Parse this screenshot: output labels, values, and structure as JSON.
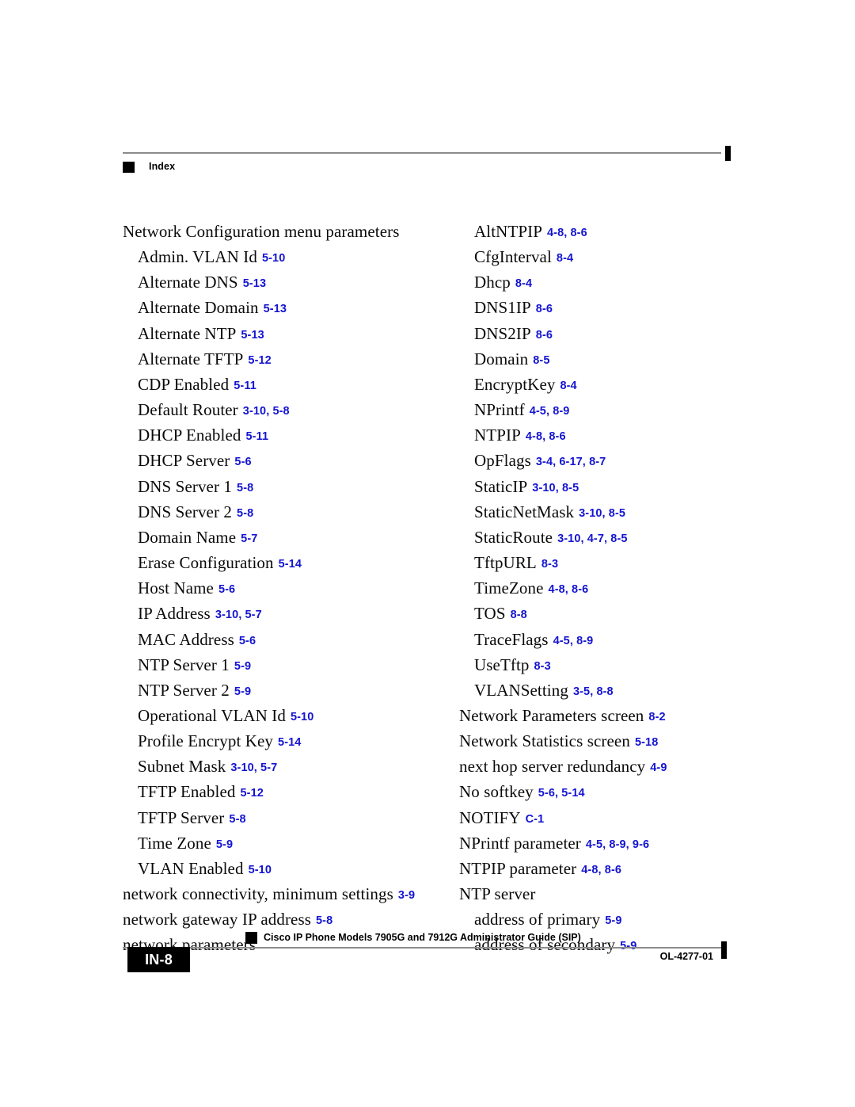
{
  "header": {
    "section_label": "Index"
  },
  "columns": {
    "left": [
      {
        "level": 1,
        "term": "Network Configuration menu parameters",
        "refs": ""
      },
      {
        "level": 2,
        "term": "Admin. VLAN Id",
        "refs": "5-10"
      },
      {
        "level": 2,
        "term": "Alternate DNS",
        "refs": "5-13"
      },
      {
        "level": 2,
        "term": "Alternate Domain",
        "refs": "5-13"
      },
      {
        "level": 2,
        "term": "Alternate NTP",
        "refs": "5-13"
      },
      {
        "level": 2,
        "term": "Alternate TFTP",
        "refs": "5-12"
      },
      {
        "level": 2,
        "term": "CDP Enabled",
        "refs": "5-11"
      },
      {
        "level": 2,
        "term": "Default Router",
        "refs": "3-10, 5-8"
      },
      {
        "level": 2,
        "term": "DHCP Enabled",
        "refs": "5-11"
      },
      {
        "level": 2,
        "term": "DHCP Server",
        "refs": "5-6"
      },
      {
        "level": 2,
        "term": "DNS Server 1",
        "refs": "5-8"
      },
      {
        "level": 2,
        "term": "DNS Server 2",
        "refs": "5-8"
      },
      {
        "level": 2,
        "term": "Domain Name",
        "refs": "5-7"
      },
      {
        "level": 2,
        "term": "Erase Configuration",
        "refs": "5-14"
      },
      {
        "level": 2,
        "term": "Host Name",
        "refs": "5-6"
      },
      {
        "level": 2,
        "term": "IP Address",
        "refs": "3-10, 5-7"
      },
      {
        "level": 2,
        "term": "MAC Address",
        "refs": "5-6"
      },
      {
        "level": 2,
        "term": "NTP Server 1",
        "refs": "5-9"
      },
      {
        "level": 2,
        "term": "NTP Server 2",
        "refs": "5-9"
      },
      {
        "level": 2,
        "term": "Operational VLAN Id",
        "refs": "5-10"
      },
      {
        "level": 2,
        "term": "Profile Encrypt Key",
        "refs": "5-14"
      },
      {
        "level": 2,
        "term": "Subnet Mask",
        "refs": "3-10, 5-7"
      },
      {
        "level": 2,
        "term": "TFTP Enabled",
        "refs": "5-12"
      },
      {
        "level": 2,
        "term": "TFTP Server",
        "refs": "5-8"
      },
      {
        "level": 2,
        "term": "Time Zone",
        "refs": "5-9"
      },
      {
        "level": 2,
        "term": "VLAN Enabled",
        "refs": "5-10"
      },
      {
        "level": 1,
        "term": "network connectivity, minimum settings",
        "refs": "3-9"
      },
      {
        "level": 1,
        "term": "network gateway IP address",
        "refs": "5-8"
      },
      {
        "level": 1,
        "term": "network parameters",
        "refs": ""
      }
    ],
    "right": [
      {
        "level": 2,
        "term": "AltNTPIP",
        "refs": "4-8, 8-6"
      },
      {
        "level": 2,
        "term": "CfgInterval",
        "refs": "8-4"
      },
      {
        "level": 2,
        "term": "Dhcp",
        "refs": "8-4"
      },
      {
        "level": 2,
        "term": "DNS1IP",
        "refs": "8-6"
      },
      {
        "level": 2,
        "term": "DNS2IP",
        "refs": "8-6"
      },
      {
        "level": 2,
        "term": "Domain",
        "refs": "8-5"
      },
      {
        "level": 2,
        "term": "EncryptKey",
        "refs": "8-4"
      },
      {
        "level": 2,
        "term": "NPrintf",
        "refs": "4-5, 8-9"
      },
      {
        "level": 2,
        "term": "NTPIP",
        "refs": "4-8, 8-6"
      },
      {
        "level": 2,
        "term": "OpFlags",
        "refs": "3-4, 6-17, 8-7"
      },
      {
        "level": 2,
        "term": "StaticIP",
        "refs": "3-10, 8-5"
      },
      {
        "level": 2,
        "term": "StaticNetMask",
        "refs": "3-10, 8-5"
      },
      {
        "level": 2,
        "term": "StaticRoute",
        "refs": "3-10, 4-7, 8-5"
      },
      {
        "level": 2,
        "term": "TftpURL",
        "refs": "8-3"
      },
      {
        "level": 2,
        "term": "TimeZone",
        "refs": "4-8, 8-6"
      },
      {
        "level": 2,
        "term": "TOS",
        "refs": "8-8"
      },
      {
        "level": 2,
        "term": "TraceFlags",
        "refs": "4-5, 8-9"
      },
      {
        "level": 2,
        "term": "UseTftp",
        "refs": "8-3"
      },
      {
        "level": 2,
        "term": "VLANSetting",
        "refs": "3-5, 8-8"
      },
      {
        "level": 1,
        "term": "Network Parameters screen",
        "refs": "8-2"
      },
      {
        "level": 1,
        "term": "Network Statistics screen",
        "refs": "5-18"
      },
      {
        "level": 1,
        "term": "next hop server redundancy",
        "refs": "4-9"
      },
      {
        "level": 1,
        "term": "No softkey",
        "refs": "5-6, 5-14"
      },
      {
        "level": 1,
        "term": "NOTIFY",
        "refs": "C-1"
      },
      {
        "level": 1,
        "term": "NPrintf parameter",
        "refs": "4-5, 8-9, 9-6"
      },
      {
        "level": 1,
        "term": "NTPIP parameter",
        "refs": "4-8, 8-6"
      },
      {
        "level": 1,
        "term": "NTP server",
        "refs": ""
      },
      {
        "level": 2,
        "term": "address of primary",
        "refs": "5-9"
      },
      {
        "level": 2,
        "term": "address of secondary",
        "refs": "5-9"
      }
    ]
  },
  "footer": {
    "document_title": "Cisco IP Phone Models 7905G and 7912G Administrator Guide (SIP)",
    "page_number": "IN-8",
    "document_number": "OL-4277-01"
  },
  "colors": {
    "reference_blue": "#1414d2",
    "rule_gray": "#8c8c8c",
    "marker_black": "#000000"
  }
}
